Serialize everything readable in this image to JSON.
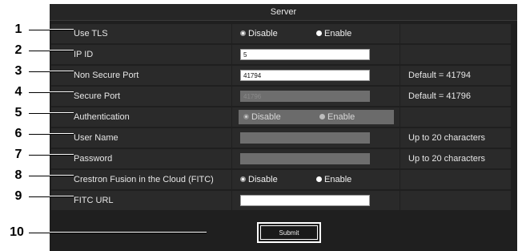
{
  "panel": {
    "title": "Server",
    "rows": [
      {
        "label": "Use TLS",
        "type": "radio",
        "options": [
          "Disable",
          "Enable"
        ],
        "selected": "Disable",
        "disabled": false,
        "note": ""
      },
      {
        "label": "IP ID",
        "type": "text",
        "value": "5",
        "disabled": false,
        "note": ""
      },
      {
        "label": "Non Secure Port",
        "type": "text",
        "value": "41794",
        "disabled": false,
        "note": "Default = 41794"
      },
      {
        "label": "Secure Port",
        "type": "text",
        "value": "41796",
        "disabled": true,
        "note": "Default = 41796"
      },
      {
        "label": "Authentication",
        "type": "radio",
        "options": [
          "Disable",
          "Enable"
        ],
        "selected": "Disable",
        "disabled": true,
        "note": ""
      },
      {
        "label": "User Name",
        "type": "text",
        "value": "",
        "disabled": true,
        "note": "Up to 20 characters"
      },
      {
        "label": "Password",
        "type": "text",
        "value": "",
        "disabled": true,
        "note": "Up to 20 characters"
      },
      {
        "label": "Crestron Fusion in the Cloud (FITC)",
        "type": "radio",
        "options": [
          "Disable",
          "Enable"
        ],
        "selected": "Disable",
        "disabled": false,
        "note": ""
      },
      {
        "label": "FITC URL",
        "type": "text",
        "value": "",
        "disabled": false,
        "note": ""
      }
    ],
    "submit_label": "Submit"
  },
  "callouts": [
    "1",
    "2",
    "3",
    "4",
    "5",
    "6",
    "7",
    "8",
    "9",
    "10"
  ],
  "colors": {
    "panel_background": "#1f1f1f",
    "row_background": "#2a2a2a",
    "disabled_field": "#6e6e6e",
    "text": "#e6e6e6"
  }
}
